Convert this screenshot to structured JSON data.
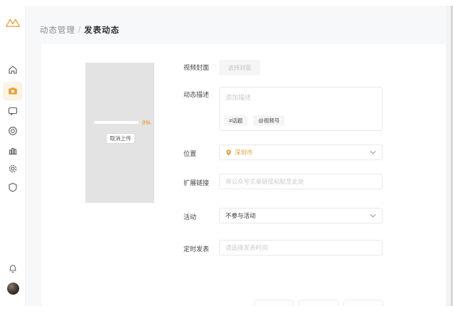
{
  "colors": {
    "accent": "#e3a23f",
    "accent_bg": "#fdf3e4",
    "card_bg": "#ffffff",
    "page_bg": "#f7f8f9",
    "preview_bg": "#e3e3e4"
  },
  "breadcrumb": {
    "section": "动态管理",
    "separator": "/",
    "current": "发表动态"
  },
  "sidebar": {
    "logo_icon": "channels-logo",
    "items": [
      {
        "icon": "home-icon",
        "active": false
      },
      {
        "icon": "camera-icon",
        "active": true
      },
      {
        "icon": "comment-icon",
        "active": false
      },
      {
        "icon": "record-icon",
        "active": false
      },
      {
        "icon": "stats-icon",
        "active": false
      },
      {
        "icon": "settings-icon",
        "active": false
      },
      {
        "icon": "shield-icon",
        "active": false
      }
    ],
    "bottom": {
      "bell_icon": "bell-icon",
      "avatar": "user-avatar"
    }
  },
  "uploader": {
    "progress_percent": 0,
    "progress_label": "0%",
    "cancel_label": "取消上传"
  },
  "form": {
    "cover": {
      "label": "视频封面",
      "button_label": "选择封面"
    },
    "description": {
      "label": "动态描述",
      "placeholder": "添加描述",
      "topic_button": "#话题",
      "mention_button": "@视频号"
    },
    "location": {
      "label": "位置",
      "value": "深圳市",
      "pin_icon": "location-pin-icon"
    },
    "link": {
      "label": "扩展链接",
      "placeholder": "将公众号文章链接粘贴至此处"
    },
    "activity": {
      "label": "活动",
      "value": "不参与活动"
    },
    "schedule": {
      "label": "定时发表",
      "placeholder": "请选择发表时间"
    }
  }
}
